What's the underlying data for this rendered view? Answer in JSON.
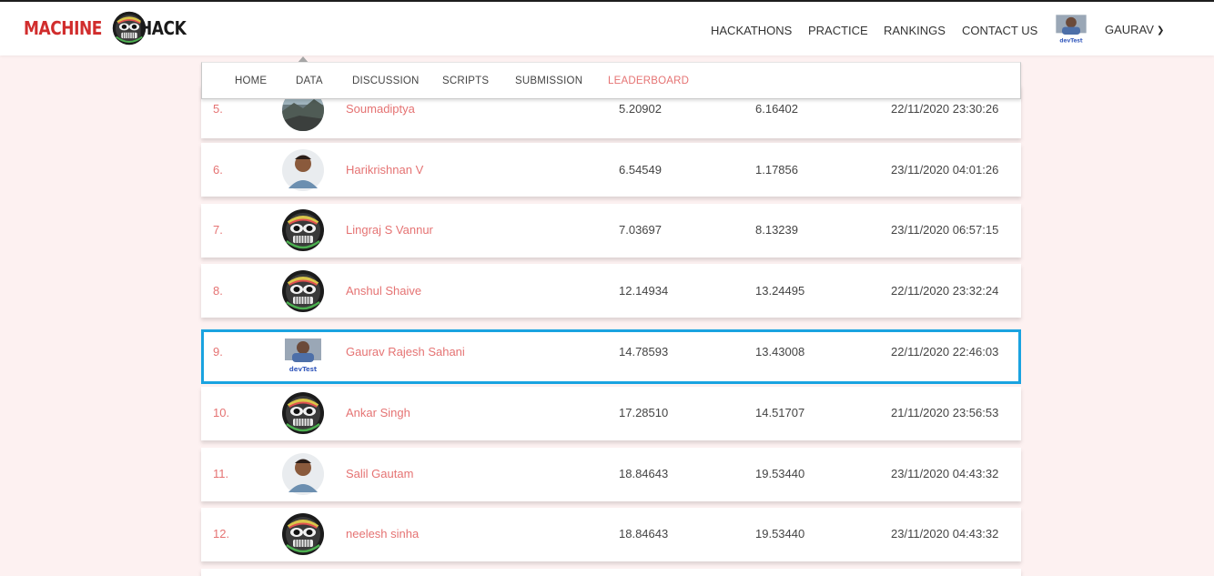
{
  "brand": {
    "left": "MACHINE",
    "right": "HACK"
  },
  "nav": {
    "items": [
      "HACKATHONS",
      "PRACTICE",
      "RANKINGS",
      "CONTACT US"
    ],
    "user": "GAURAV"
  },
  "tabs": [
    "HOME",
    "DATA",
    "DISCUSSION",
    "SCRIPTS",
    "SUBMISSION",
    "LEADERBOARD"
  ],
  "active_tab": "LEADERBOARD",
  "colors": {
    "accent": "#e57373",
    "highlight": "#1aa3e0",
    "brand_red": "#d12d2d"
  },
  "rows": [
    {
      "rank": "5.",
      "name": "Soumadiptya",
      "public": "5.20902",
      "private": "6.16402",
      "date": "22/11/2020 23:30:26",
      "avatar": "photo-landscape"
    },
    {
      "rank": "6.",
      "name": "Harikrishnan V",
      "public": "6.54549",
      "private": "1.17856",
      "date": "23/11/2020 04:01:26",
      "avatar": "photo-person"
    },
    {
      "rank": "7.",
      "name": "Lingraj S Vannur",
      "public": "7.03697",
      "private": "8.13239",
      "date": "23/11/2020 06:57:15",
      "avatar": "mask-icon"
    },
    {
      "rank": "8.",
      "name": "Anshul Shaive",
      "public": "12.14934",
      "private": "13.24495",
      "date": "22/11/2020 23:32:24",
      "avatar": "mask-icon"
    },
    {
      "rank": "9.",
      "name": "Gaurav Rajesh Sahani",
      "public": "14.78593",
      "private": "13.43008",
      "date": "22/11/2020 22:46:03",
      "avatar": "photo-devtest",
      "highlight": true
    },
    {
      "rank": "10.",
      "name": "Ankar Singh",
      "public": "17.28510",
      "private": "14.51707",
      "date": "21/11/2020 23:56:53",
      "avatar": "mask-icon"
    },
    {
      "rank": "11.",
      "name": "Salil Gautam",
      "public": "18.84643",
      "private": "19.53440",
      "date": "23/11/2020 04:43:32",
      "avatar": "photo-person"
    },
    {
      "rank": "12.",
      "name": "neelesh sinha",
      "public": "18.84643",
      "private": "19.53440",
      "date": "23/11/2020 04:43:32",
      "avatar": "mask-icon"
    }
  ],
  "avatar_caption": "devTest"
}
